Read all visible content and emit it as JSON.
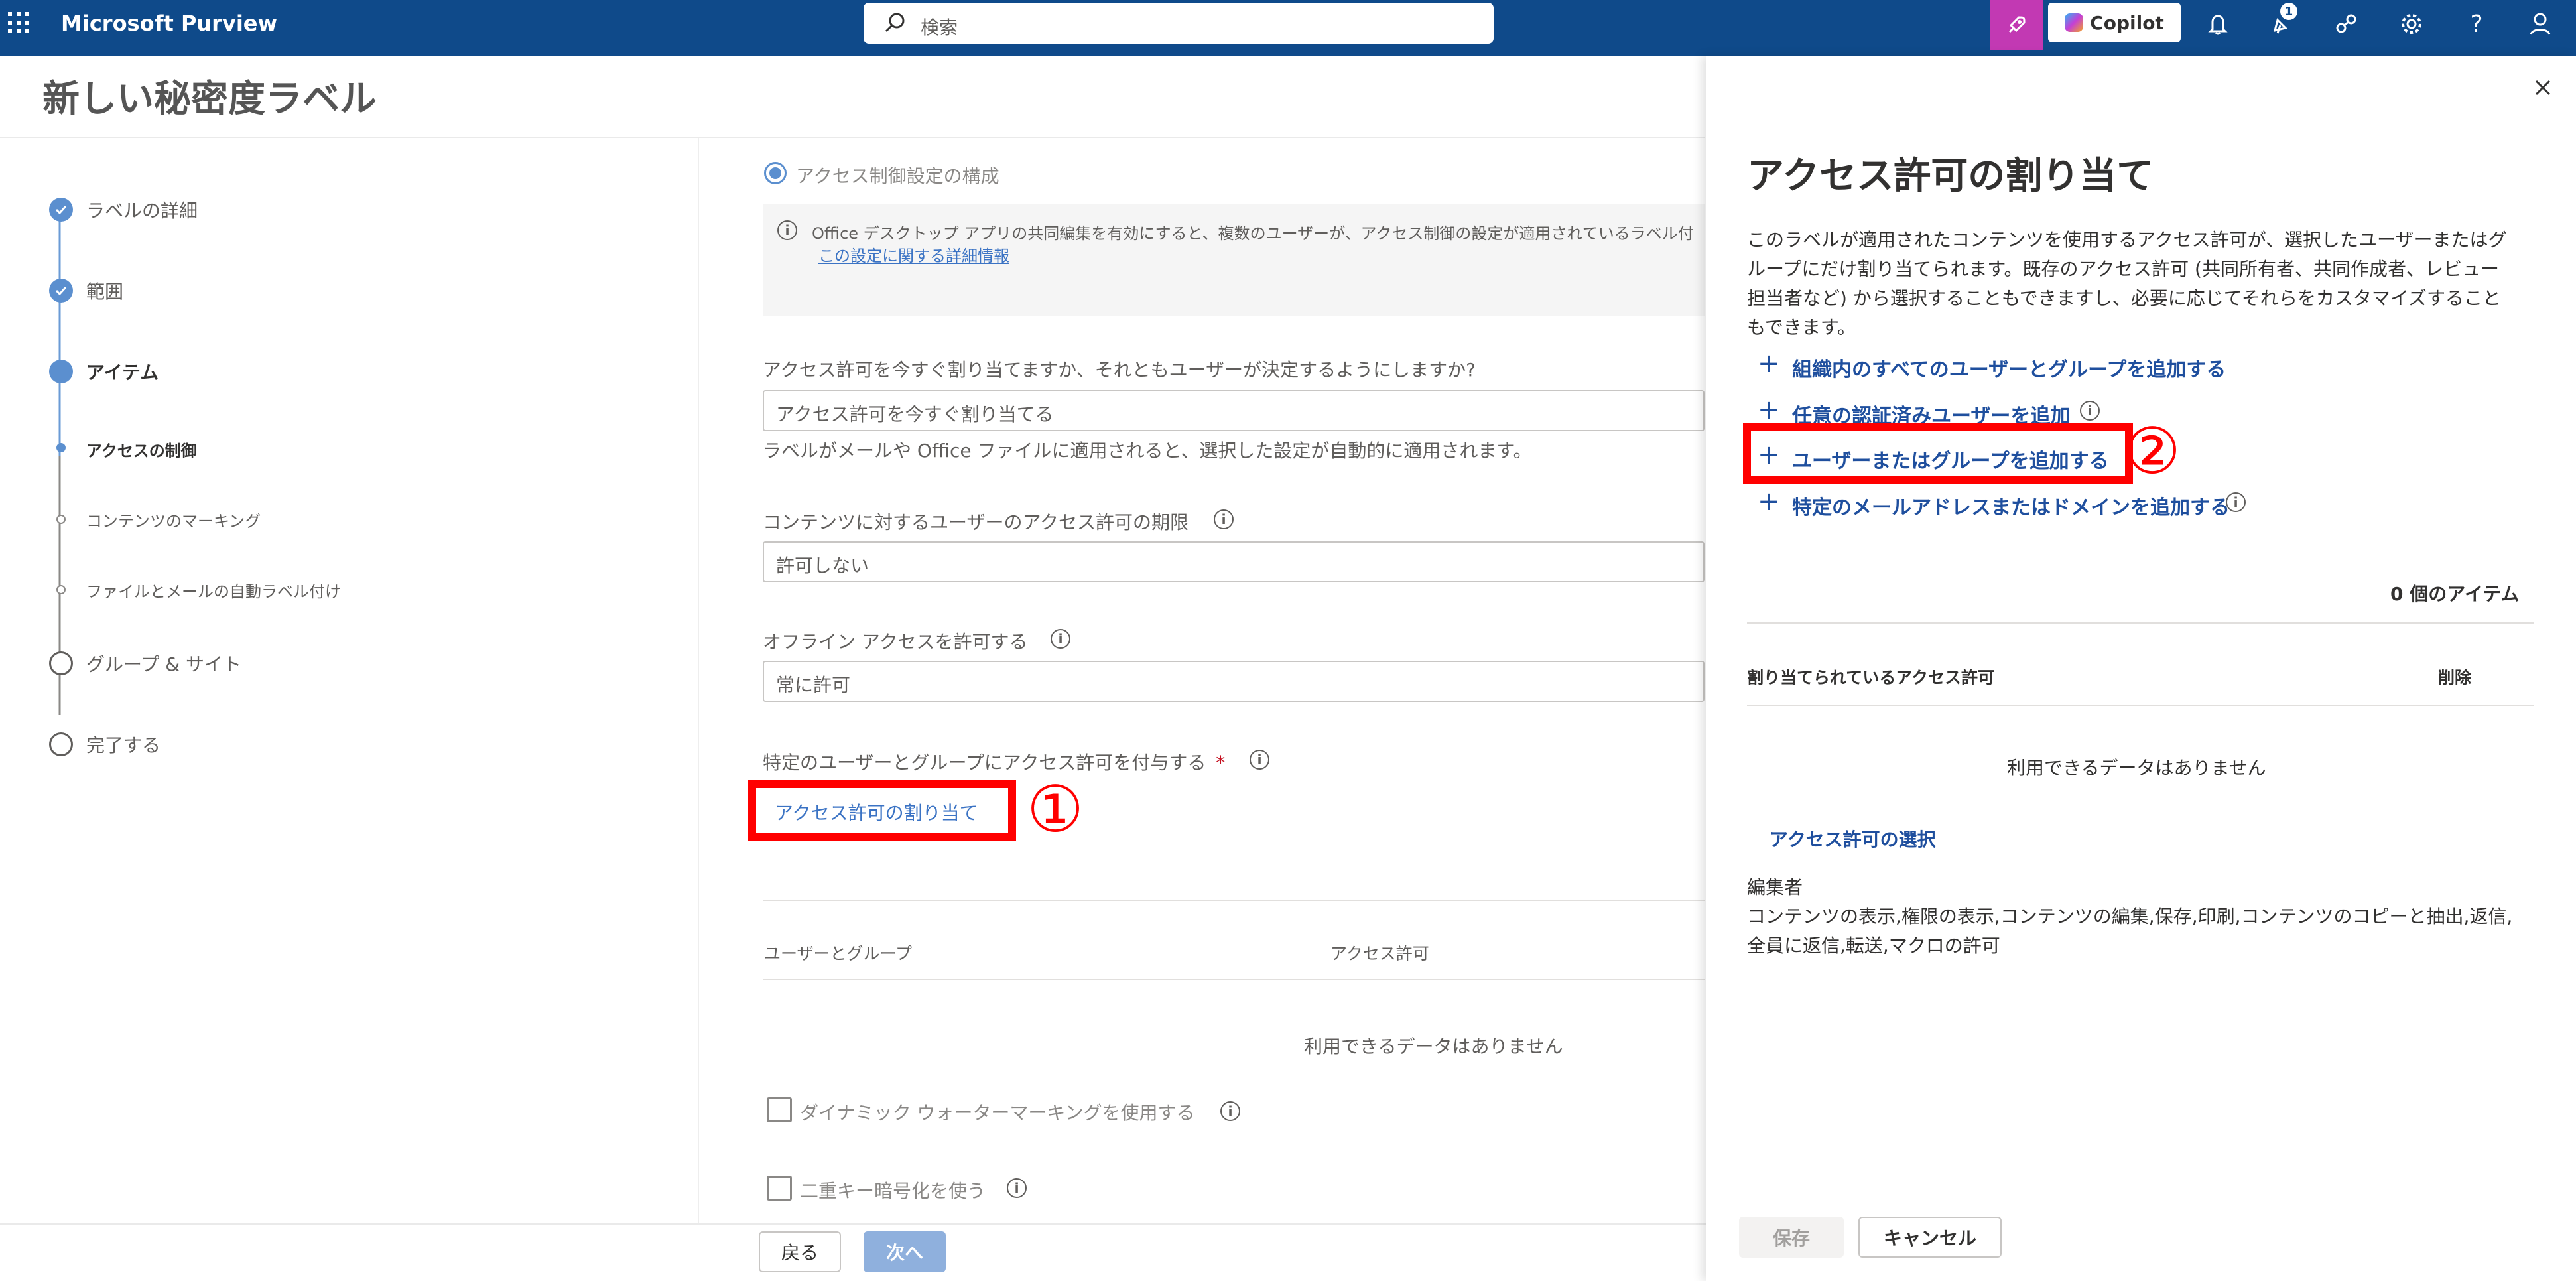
{
  "topbar": {
    "app_name": "Microsoft Purview",
    "search_placeholder": "検索",
    "copilot_label": "Copilot",
    "notification_badge": "1"
  },
  "page": {
    "title": "新しい秘密度ラベル"
  },
  "stepper": {
    "steps": [
      {
        "label": "ラベルの詳細",
        "state": "done"
      },
      {
        "label": "範囲",
        "state": "done"
      },
      {
        "label": "アイテム",
        "state": "current"
      },
      {
        "label": "アクセスの制御",
        "state": "current-sub"
      },
      {
        "label": "コンテンツのマーキング",
        "state": "pending-sub"
      },
      {
        "label": "ファイルとメールの自動ラベル付け",
        "state": "pending-sub"
      },
      {
        "label": "グループ & サイト",
        "state": "pending"
      },
      {
        "label": "完了する",
        "state": "pending"
      }
    ]
  },
  "main": {
    "radio_label": "アクセス制御設定の構成",
    "info_text": "Office デスクトップ アプリの共同編集を有効にすると、複数のユーザーが、アクセス制御の設定が適用されているラベル付",
    "info_link": "この設定に関する詳細情報",
    "assign_question": "アクセス許可を今すぐ割り当てますか、それともユーザーが決定するようにしますか?",
    "assign_value": "アクセス許可を今すぐ割り当てる",
    "assign_help": "ラベルがメールや Office ファイルに適用されると、選択した設定が自動的に適用されます。",
    "expiry_label": "コンテンツに対するユーザーのアクセス許可の期限",
    "expiry_value": "許可しない",
    "offline_label": "オフライン アクセスを許可する",
    "offline_value": "常に許可",
    "grant_label": "特定のユーザーとグループにアクセス許可を付与する",
    "required_mark": "*",
    "assign_link": "アクセス許可の割り当て",
    "annotation_1": "①",
    "table_col_users": "ユーザーとグループ",
    "table_col_perms": "アクセス許可",
    "table_empty": "利用できるデータはありません",
    "watermark_label": "ダイナミック ウォーターマーキングを使用する",
    "double_key_label": "二重キー暗号化を使う",
    "back_button": "戻る",
    "next_button": "次へ"
  },
  "panel": {
    "title": "アクセス許可の割り当て",
    "description": [
      "このラベルが適用されたコンテンツを使用するアクセス許可が、選択したユーザーまたはグ",
      "ループにだけ割り当てられます。既存のアクセス許可 (共同所有者、共同作成者、レビュー",
      "担当者など) から選択することもできますし、必要に応じてそれらをカスタマイズすること",
      "もできます。"
    ],
    "link_all_users": "組織内のすべてのユーザーとグループを追加する",
    "link_authenticated": "任意の認証済みユーザーを追加",
    "link_users_groups": "ユーザーまたはグループを追加する",
    "link_email_domain": "特定のメールアドレスまたはドメインを追加する",
    "annotation_2": "②",
    "item_count": "0 個のアイテム",
    "col_assigned": "割り当てられているアクセス許可",
    "col_delete": "削除",
    "empty_text": "利用できるデータはありません",
    "select_perm_link": "アクセス許可の選択",
    "editor_label": "編集者",
    "editor_perms": [
      "コンテンツの表示,権限の表示,コンテンツの編集,保存,印刷,コンテンツのコピーと抽出,返信,",
      "全員に返信,転送,マクロの許可"
    ],
    "save_button": "保存",
    "cancel_button": "キャンセル"
  }
}
